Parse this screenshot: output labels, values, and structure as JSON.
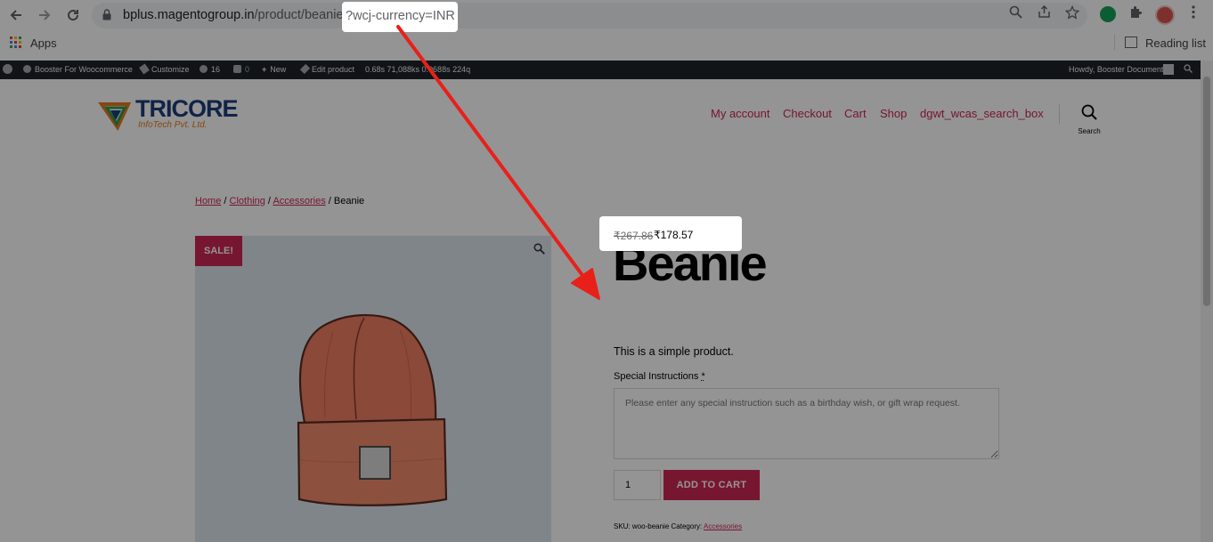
{
  "browser": {
    "url_host": "bplus.magentogroup.in",
    "url_path": "/product/beanie/",
    "url_query": "?wcj-currency=INR",
    "bookmarks": {
      "apps_label": "Apps",
      "reading_list_label": "Reading list"
    }
  },
  "admin_bar": {
    "site_name": "Booster For Woocommerce",
    "customize": "Customize",
    "updates_count": "16",
    "comments_count": "0",
    "new_label": "New",
    "edit_label": "Edit product",
    "stats": "0.68s  71,088ks  0.0688s  224q",
    "howdy": "Howdy, Booster Document"
  },
  "site": {
    "logo_name": "TRICORE",
    "logo_sub": "InfoTech Pvt. Ltd.",
    "menu": [
      "My account",
      "Checkout",
      "Cart",
      "Shop",
      "dgwt_wcas_search_box"
    ],
    "search_label": "Search"
  },
  "breadcrumb": {
    "home": "Home",
    "sep": " / ",
    "clothing": "Clothing",
    "accessories": "Accessories",
    "current": "Beanie"
  },
  "product": {
    "sale_badge": "SALE!",
    "title": "Beanie",
    "price_old": "₹267.86",
    "price_new": "₹178.57",
    "short_description": "This is a simple product.",
    "special_instructions_label": "Special Instructions",
    "required_mark": "*",
    "special_instructions_placeholder": "Please enter any special instruction such as a birthday wish, or gift wrap request.",
    "quantity": "1",
    "add_to_cart": "ADD TO CART",
    "meta_sku_label": "SKU:",
    "meta_sku": "woo-beanie",
    "meta_category_label": "Category:",
    "meta_category": "Accessories"
  },
  "colors": {
    "accent": "#cd2653",
    "admin_bar": "#1d2327",
    "annotation_arrow": "#e8201a"
  }
}
